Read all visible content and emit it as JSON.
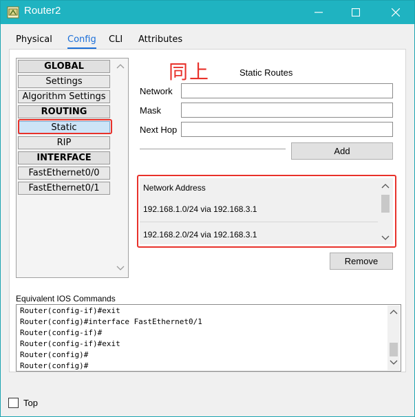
{
  "window": {
    "title": "Router2"
  },
  "tabs": [
    {
      "label": "Physical"
    },
    {
      "label": "Config"
    },
    {
      "label": "CLI"
    },
    {
      "label": "Attributes"
    }
  ],
  "sidebar": {
    "items": [
      {
        "label": "GLOBAL",
        "type": "header"
      },
      {
        "label": "Settings",
        "type": "item"
      },
      {
        "label": "Algorithm Settings",
        "type": "item"
      },
      {
        "label": "ROUTING",
        "type": "header"
      },
      {
        "label": "Static",
        "type": "item",
        "selected": true
      },
      {
        "label": "RIP",
        "type": "item"
      },
      {
        "label": "INTERFACE",
        "type": "header"
      },
      {
        "label": "FastEthernet0/0",
        "type": "item"
      },
      {
        "label": "FastEthernet0/1",
        "type": "item"
      }
    ]
  },
  "annotation": {
    "text": "同上",
    "color": "#e8312a"
  },
  "static_routes": {
    "title": "Static Routes",
    "network_label": "Network",
    "network_value": "",
    "mask_label": "Mask",
    "mask_value": "",
    "nexthop_label": "Next Hop",
    "nexthop_value": "",
    "add_label": "Add",
    "list_header": "Network Address",
    "routes": [
      "192.168.1.0/24 via 192.168.3.1",
      "192.168.2.0/24 via 192.168.3.1"
    ],
    "remove_label": "Remove"
  },
  "ios": {
    "label": "Equivalent IOS Commands",
    "lines": [
      "Router(config-if)#exit",
      "Router(config)#interface FastEthernet0/1",
      "Router(config-if)#",
      "Router(config-if)#exit",
      "Router(config)#",
      "Router(config)#"
    ]
  },
  "footer": {
    "top_label": "Top",
    "top_checked": false
  },
  "colors": {
    "titlebar": "#1fb3c1",
    "accent": "#1a6ed8",
    "highlight": "#e8312a"
  }
}
